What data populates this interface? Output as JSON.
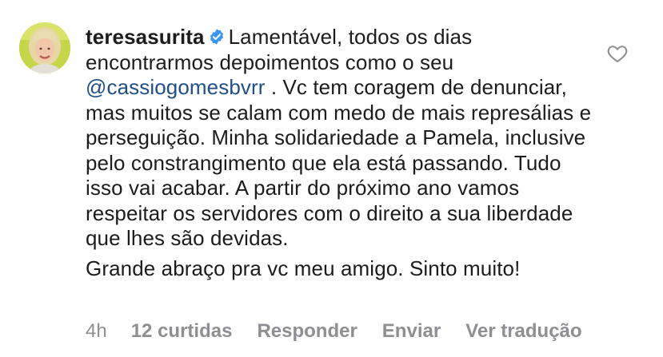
{
  "comment": {
    "username": "teresasurita",
    "verified_icon": "verified-badge-icon",
    "text_before_mention": "Lamentável, todos os dias encontrarmos depoimentos como o seu",
    "mention": "@cassiogomesbvrr",
    "text_after_mention": ". Vc tem coragem de denunciar, mas muitos se calam com medo de mais represálias e perseguição. Minha solidariedade a Pamela, inclusive pelo constrangimento que ela está passando. Tudo isso vai acabar. A partir do próximo ano vamos respeitar os servidores com o direito a sua liberdade que lhes são devidas.",
    "second_paragraph": "Grande abraço pra vc meu amigo. Sinto muito!"
  },
  "actions": {
    "timestamp": "4h",
    "likes_label": "12 curtidas",
    "reply_label": "Responder",
    "send_label": "Enviar",
    "translate_label": "Ver tradução"
  },
  "icons": {
    "like": "heart-outline-icon",
    "avatar": "avatar"
  },
  "colors": {
    "text": "#1c1c1e",
    "mention": "#1f4f86",
    "muted": "#8e8e93",
    "verified": "#3897f0",
    "background": "#ffffff"
  }
}
